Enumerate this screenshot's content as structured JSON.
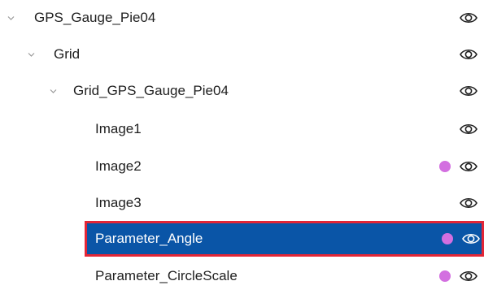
{
  "colors": {
    "selection_bg": "#0a55a7",
    "selection_border": "#e32636",
    "dot": "#d36fe0",
    "text": "#1f1f1f",
    "chevron": "#9a9a9a"
  },
  "tree": {
    "items": [
      {
        "label": "GPS_Gauge_Pie04",
        "expanded": true,
        "has_dot": false,
        "selected": false
      },
      {
        "label": "Grid",
        "expanded": true,
        "has_dot": false,
        "selected": false
      },
      {
        "label": "Grid_GPS_Gauge_Pie04",
        "expanded": true,
        "has_dot": false,
        "selected": false
      },
      {
        "label": "Image1",
        "expanded": null,
        "has_dot": false,
        "selected": false
      },
      {
        "label": "Image2",
        "expanded": null,
        "has_dot": true,
        "selected": false
      },
      {
        "label": "Image3",
        "expanded": null,
        "has_dot": false,
        "selected": false
      },
      {
        "label": "Parameter_Angle",
        "expanded": null,
        "has_dot": true,
        "selected": true
      },
      {
        "label": "Parameter_CircleScale",
        "expanded": null,
        "has_dot": true,
        "selected": false
      }
    ]
  }
}
